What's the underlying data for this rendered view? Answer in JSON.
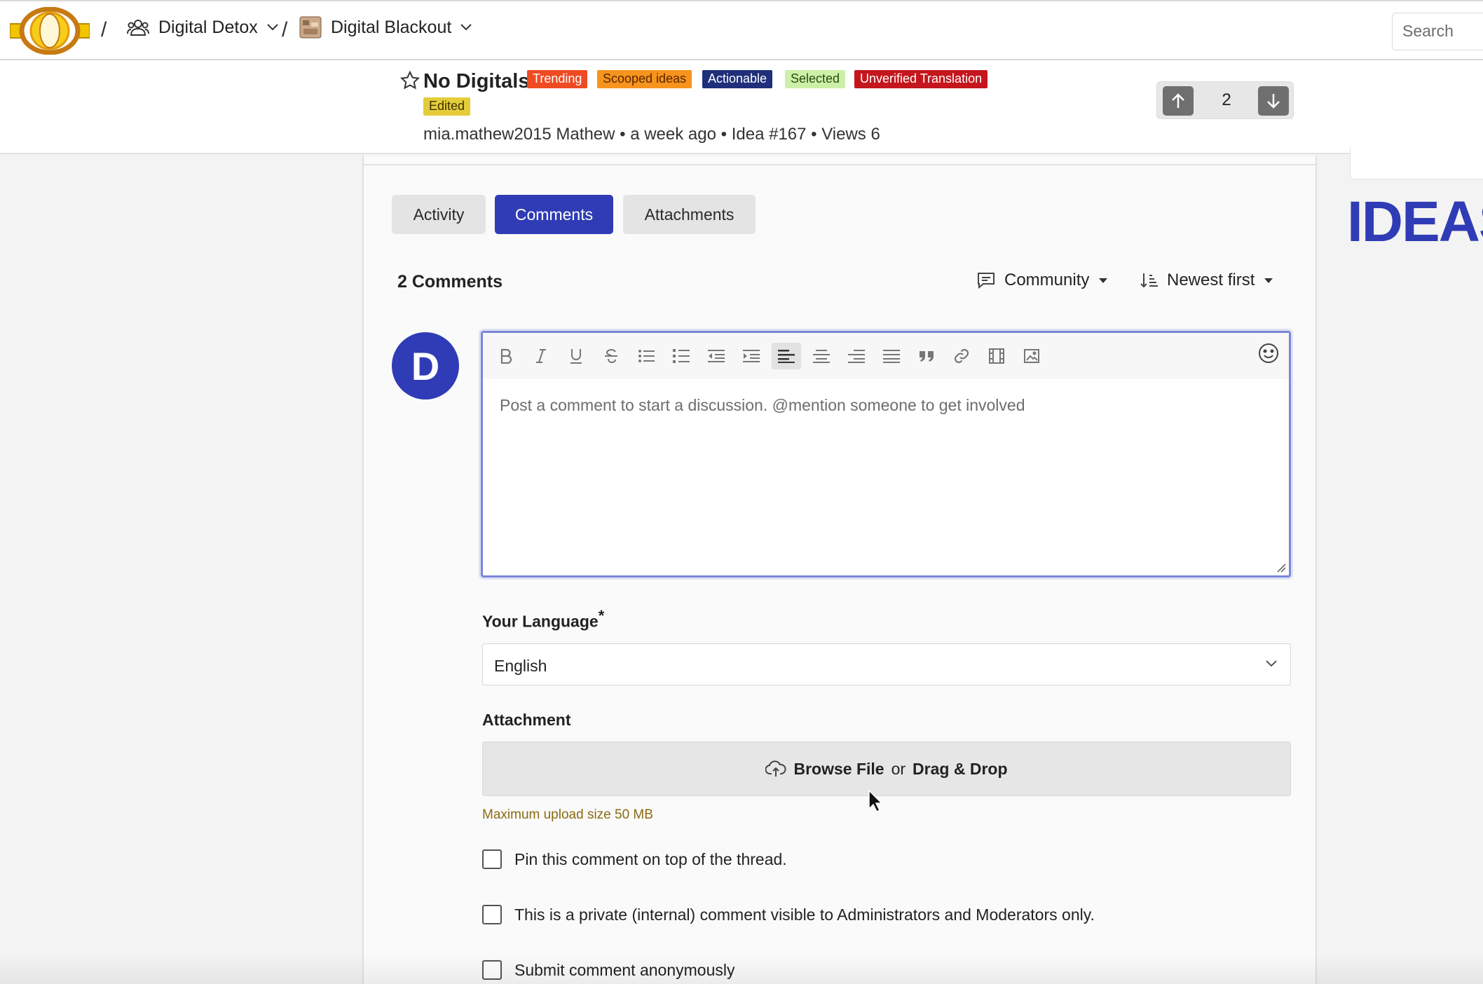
{
  "nav": {
    "separator": "/",
    "community_label": "Digital Detox",
    "campaign_label": "Digital Blackout",
    "search_placeholder": "Search"
  },
  "idea": {
    "title": "No Digitals",
    "tags": [
      {
        "label": "Trending",
        "bg": "#f04a23",
        "fg": "#ffffff"
      },
      {
        "label": "Scooped ideas",
        "bg": "#f7941d",
        "fg": "#5a2500"
      },
      {
        "label": "Actionable",
        "bg": "#1f2f7a",
        "fg": "#ffffff"
      },
      {
        "label": "Selected",
        "bg": "#cdf0a8",
        "fg": "#2b4a12"
      },
      {
        "label": "Unverified Translation",
        "bg": "#c4161c",
        "fg": "#ffffff"
      },
      {
        "label": "Edited",
        "bg": "#e5cc39",
        "fg": "#3a3200"
      }
    ],
    "meta": "mia.mathew2015 Mathew • a week ago • Idea #167 • Views 6",
    "vote_count": "2"
  },
  "tabs": [
    {
      "label": "Activity"
    },
    {
      "label": "Comments"
    },
    {
      "label": "Attachments"
    }
  ],
  "comments": {
    "count_label": "2 Comments",
    "filter_label": "Community",
    "sort_label": "Newest first",
    "avatar_initial": "D",
    "placeholder": "Post a comment to start a discussion. @mention someone to get involved"
  },
  "form": {
    "language_label": "Your Language",
    "required_mark": "*",
    "language_value": "English",
    "attachment_label": "Attachment",
    "browse_label": "Browse File",
    "or_label": "or",
    "drag_label": "Drag & Drop",
    "upload_hint": "Maximum upload size 50 MB",
    "checkboxes": [
      {
        "label": "Pin this comment on top of the thread."
      },
      {
        "label": "This is a private (internal) comment visible to Administrators and Moderators only."
      },
      {
        "label": "Submit comment anonymously"
      }
    ]
  },
  "sidebar": {
    "brand_text": "IDEAS"
  },
  "colors": {
    "accent": "#2f3cb5",
    "vote_button": "#6f6f6f"
  }
}
